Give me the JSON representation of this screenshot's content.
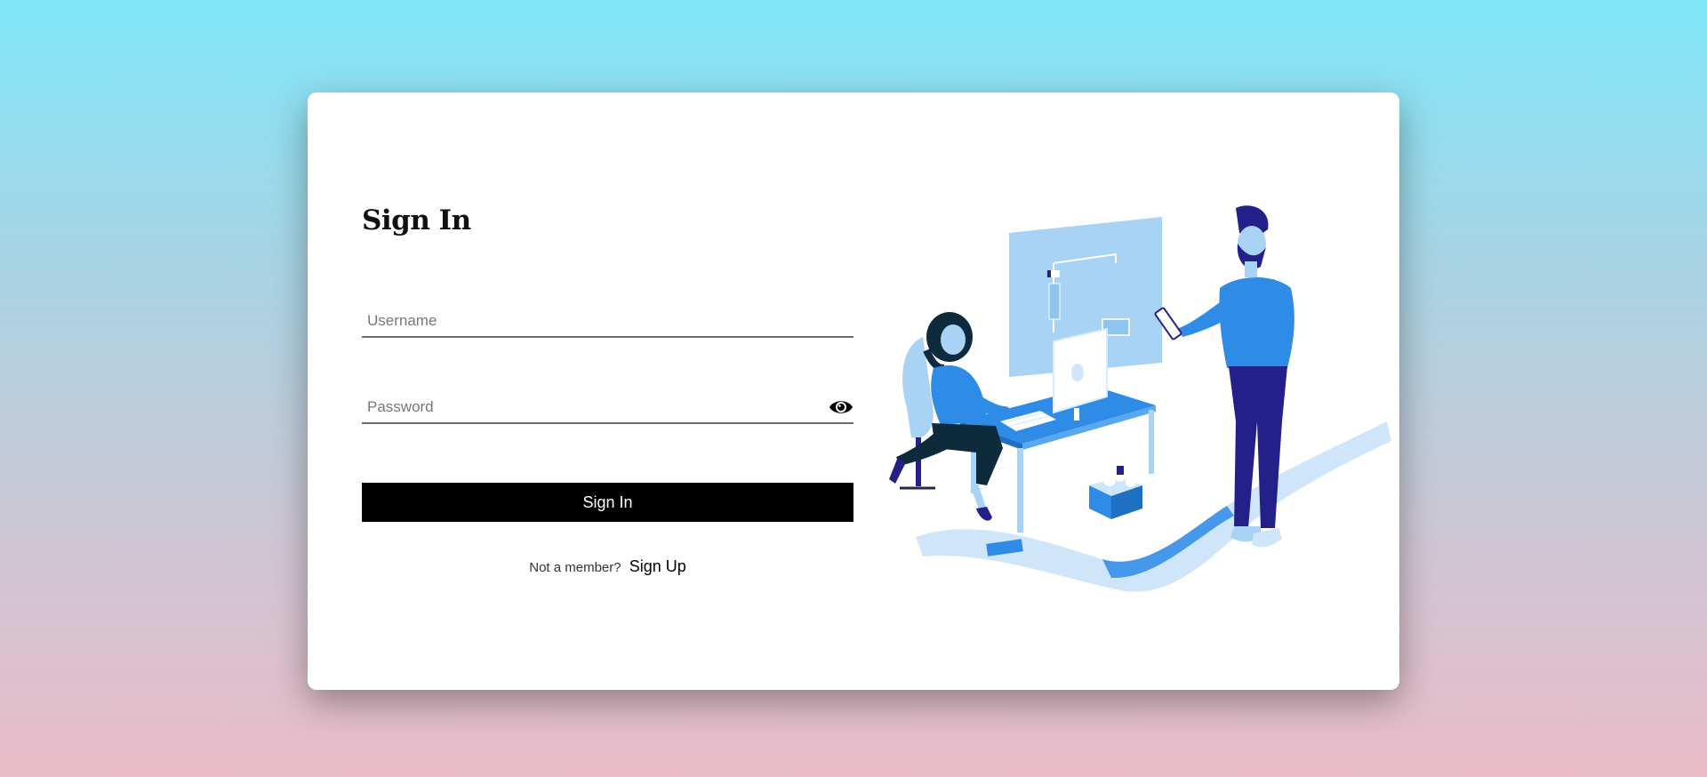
{
  "form": {
    "title": "Sign In",
    "username_placeholder": "Username",
    "password_placeholder": "Password",
    "submit_label": "Sign In",
    "signup_prompt": "Not a member?",
    "signup_link": "Sign Up"
  },
  "icons": {
    "password_toggle": "eye-icon"
  },
  "colors": {
    "button_bg": "#000000",
    "illustration_blue": "#2e8be6",
    "illustration_navy": "#24208a"
  }
}
